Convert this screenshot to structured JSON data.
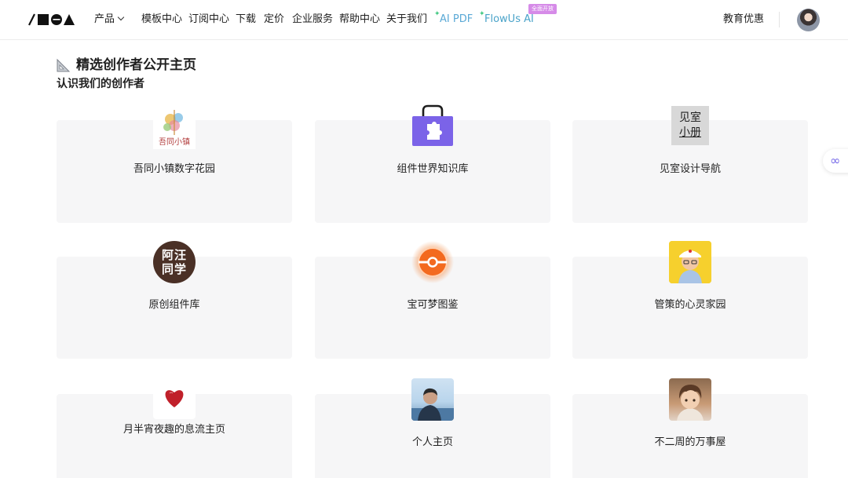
{
  "nav": {
    "product": "产品",
    "templates": "模板中心",
    "subscription": "订阅中心",
    "download": "下载",
    "pricing": "定价",
    "enterprise": "企业服务",
    "help": "帮助中心",
    "about": "关于我们",
    "ai_pdf": "AI PDF",
    "flowus_ai": "FlowUs AI",
    "flowus_ai_badge": "全面开放",
    "education": "教育优惠"
  },
  "page": {
    "heading": "精选创作者公开主页",
    "subheading": "认识我们的创作者"
  },
  "creators": [
    {
      "name": "吾同小镇数字花园",
      "icon": "wutong-town-logo"
    },
    {
      "name": "组件世界知识库",
      "icon": "puzzle-bag-icon"
    },
    {
      "name": "见室设计导航",
      "icon": "jianshi-logo",
      "logo_text_line1": "见室",
      "logo_text_line2": "小册"
    },
    {
      "name": "原创组件库",
      "icon": "awang-logo",
      "logo_text_line1": "阿汪",
      "logo_text_line2": "同学"
    },
    {
      "name": "宝可梦图鉴",
      "icon": "pokeball-icon"
    },
    {
      "name": "管策的心灵家园",
      "icon": "guance-avatar"
    },
    {
      "name": "月半宵夜趣的息流主页",
      "icon": "heart-icon"
    },
    {
      "name": "个人主页",
      "icon": "person-avatar"
    },
    {
      "name": "不二周的万事屋",
      "icon": "anime-avatar"
    }
  ],
  "colors": {
    "card_bg": "#f6f6f7",
    "puzzle_purple": "#7b63e8",
    "pokeball_orange": "#f07a2a",
    "ai_green": "#44c983",
    "badge_pink": "#d68be8"
  }
}
